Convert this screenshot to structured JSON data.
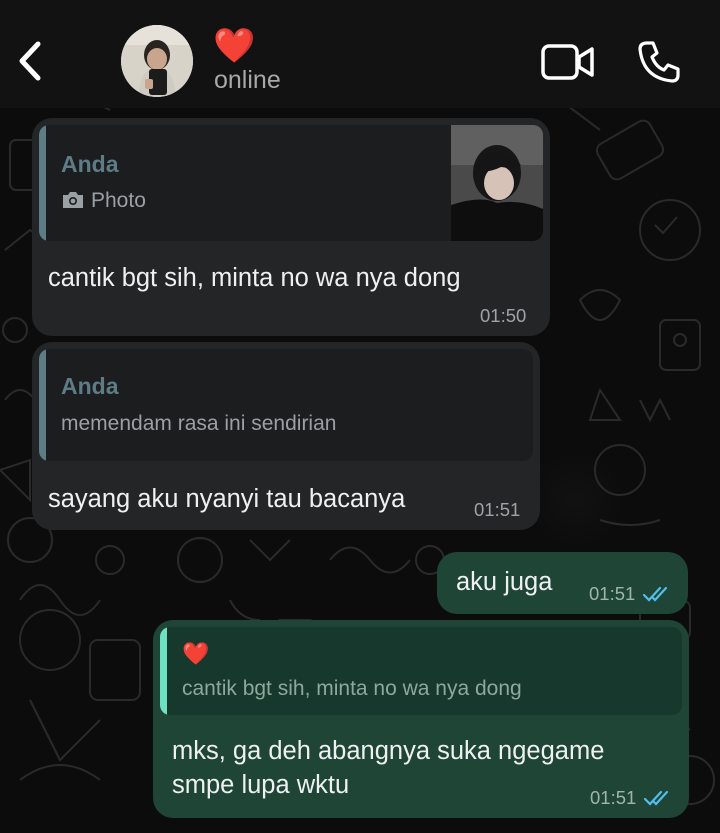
{
  "header": {
    "contact_name_emoji": "❤️",
    "status": "online",
    "icons": [
      "back-chevron-icon",
      "video-camera-icon",
      "phone-icon"
    ]
  },
  "messages": [
    {
      "direction": "incoming",
      "quote": {
        "author": "Anda",
        "type_label": "Photo",
        "has_thumbnail": true
      },
      "text": "cantik bgt sih, minta no wa nya dong",
      "time": "01:50"
    },
    {
      "direction": "incoming",
      "quote": {
        "author": "Anda",
        "text": "memendam rasa ini sendirian"
      },
      "text": "sayang aku nyanyi tau bacanya",
      "time": "01:51"
    },
    {
      "direction": "outgoing",
      "text": "aku juga",
      "time": "01:51",
      "status": "read"
    },
    {
      "direction": "outgoing",
      "quote": {
        "author_emoji": "❤️",
        "text": "cantik bgt sih, minta no wa nya dong"
      },
      "text_lines": [
        "mks, ga deh abangnya suka ngegame",
        "smpe lupa wktu"
      ],
      "time": "01:51",
      "status": "read"
    }
  ],
  "colors": {
    "incoming_bubble": "#232527",
    "outgoing_bubble": "#1e4536",
    "read_ticks": "#53bdeb",
    "quote_bar_incoming": "#5e7c86",
    "quote_bar_outgoing": "#6fe0c0"
  }
}
